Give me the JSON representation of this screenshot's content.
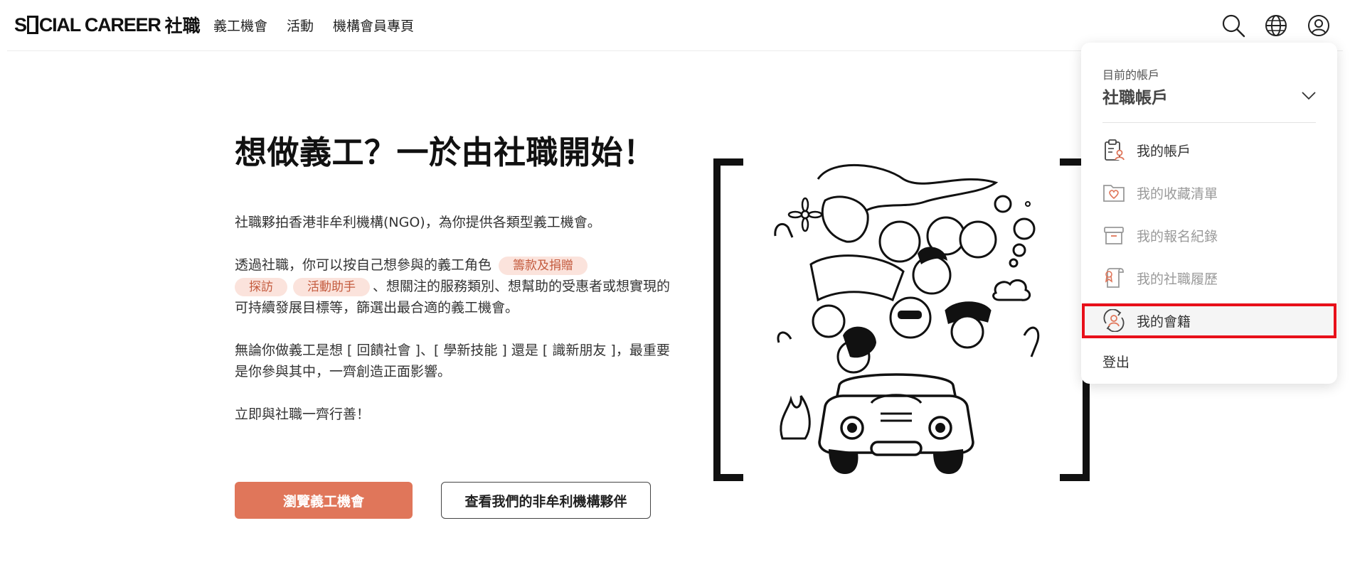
{
  "header": {
    "logo_text": "S[ ]CIAL CAREER 社職",
    "logo_left": "S",
    "logo_right": "CIAL CAREER",
    "logo_zh": "社職",
    "nav": [
      {
        "label": "義工機會"
      },
      {
        "label": "活動"
      },
      {
        "label": "機構會員專頁"
      }
    ]
  },
  "hero": {
    "title": "想做義工？一於由社職開始！",
    "p1": "社職夥拍香港非牟利機構(NGO)，為你提供各類型義工機會。",
    "p2_a": "透過社職，你可以按自己想參與的義工角色",
    "tags": [
      "籌款及捐贈",
      "探訪",
      "活動助手"
    ],
    "p2_b": "、想關注的服務類別、想幫助的受惠者或想實現的可持續發展目標等，篩選出最合適的義工機會。",
    "p3": "無論你做義工是想 [ 回饋社會 ]、[ 學新技能 ] 還是 [ 識新朋友 ]，最重要是你參與其中，一齊創造正面影響。",
    "p4": "立即與社職一齊行善！",
    "btn_primary": "瀏覽義工機會",
    "btn_secondary": "查看我們的非牟利機構夥伴"
  },
  "dropdown": {
    "account_label": "目前的帳戶",
    "account_name": "社職帳戶",
    "items": [
      {
        "label": "我的帳戶",
        "icon": "clipboard-user-icon"
      },
      {
        "label": "我的收藏清單",
        "icon": "heart-folder-icon"
      },
      {
        "label": "我的報名紀錄",
        "icon": "archive-box-icon"
      },
      {
        "label": "我的社職履歷",
        "icon": "certificate-icon"
      },
      {
        "label": "我的會籍",
        "icon": "membership-cycle-icon"
      }
    ],
    "logout": "登出"
  },
  "colors": {
    "accent": "#e0765a",
    "tag_bg": "#fbe3dc",
    "tag_text": "#c45b3e",
    "highlight": "#e8101a"
  }
}
